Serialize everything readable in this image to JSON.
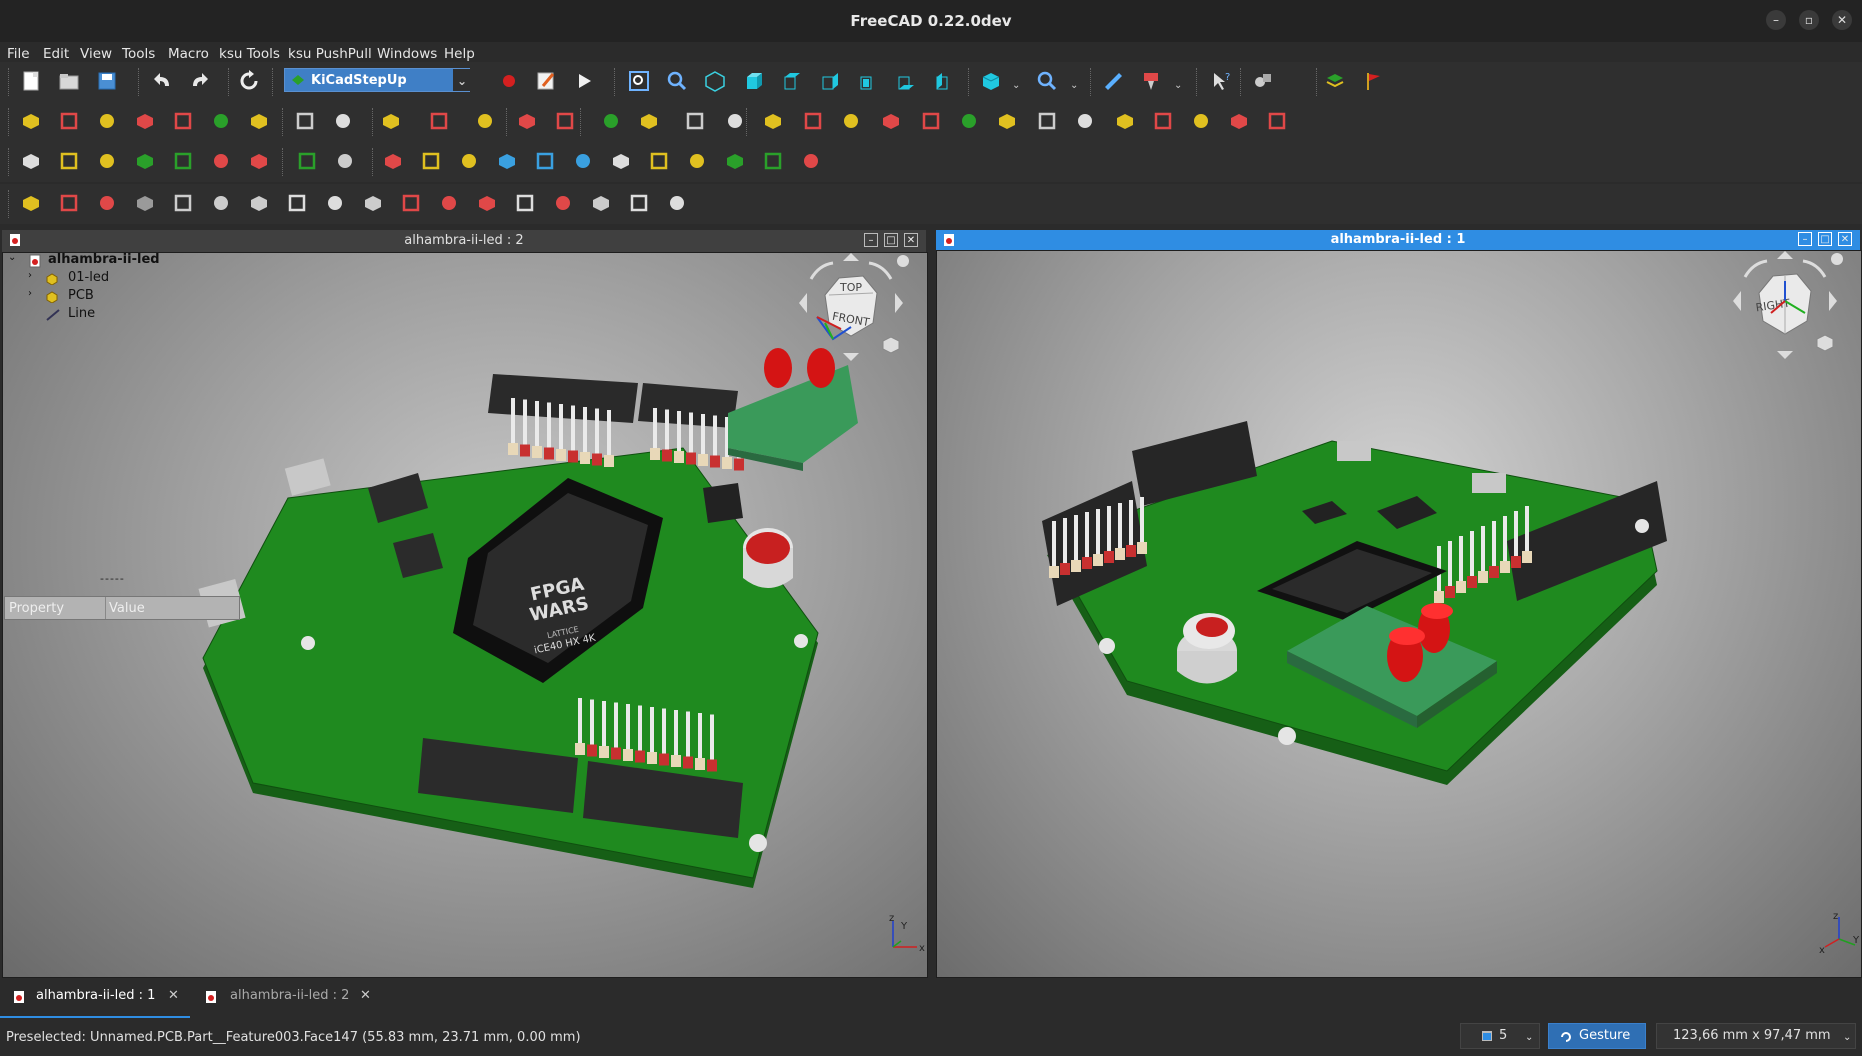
{
  "window": {
    "title": "FreeCAD 0.22.0dev"
  },
  "menubar": {
    "items": [
      "File",
      "Edit",
      "View",
      "Tools",
      "Macro",
      "ksu Tools",
      "ksu PushPull",
      "Windows",
      "Help"
    ]
  },
  "toolbar": {
    "workbench": "KiCadStepUp"
  },
  "views": {
    "left": {
      "title": "alhambra-ii-led : 2",
      "navcube_top": "TOP",
      "navcube_front": "FRONT"
    },
    "right": {
      "title": "alhambra-ii-led : 1",
      "navcube_right": "RIGHT"
    }
  },
  "tree": {
    "root": "alhambra-ii-led",
    "items": [
      "01-led",
      "PCB",
      "Line"
    ]
  },
  "properties": {
    "separator": "-----",
    "headers": [
      "Property",
      "Value"
    ]
  },
  "board": {
    "chip_text": [
      "FPGA",
      "WARS",
      "LATTICE",
      "iCE40 HX 4K"
    ]
  },
  "tabs": [
    {
      "label": "alhambra-ii-led : 1",
      "active": true
    },
    {
      "label": "alhambra-ii-led : 2",
      "active": false
    }
  ],
  "status": {
    "preselected": "Preselected: Unnamed.PCB.Part__Feature003.Face147 (55.83 mm, 23.71 mm, 0.00 mm)",
    "page_count": "5",
    "nav_style": "Gesture",
    "dimensions": "123,66 mm x 97,47 mm"
  },
  "colors": {
    "accent": "#2f8de3",
    "pcb_green": "#1c7a1c",
    "led_red": "#d41414"
  }
}
